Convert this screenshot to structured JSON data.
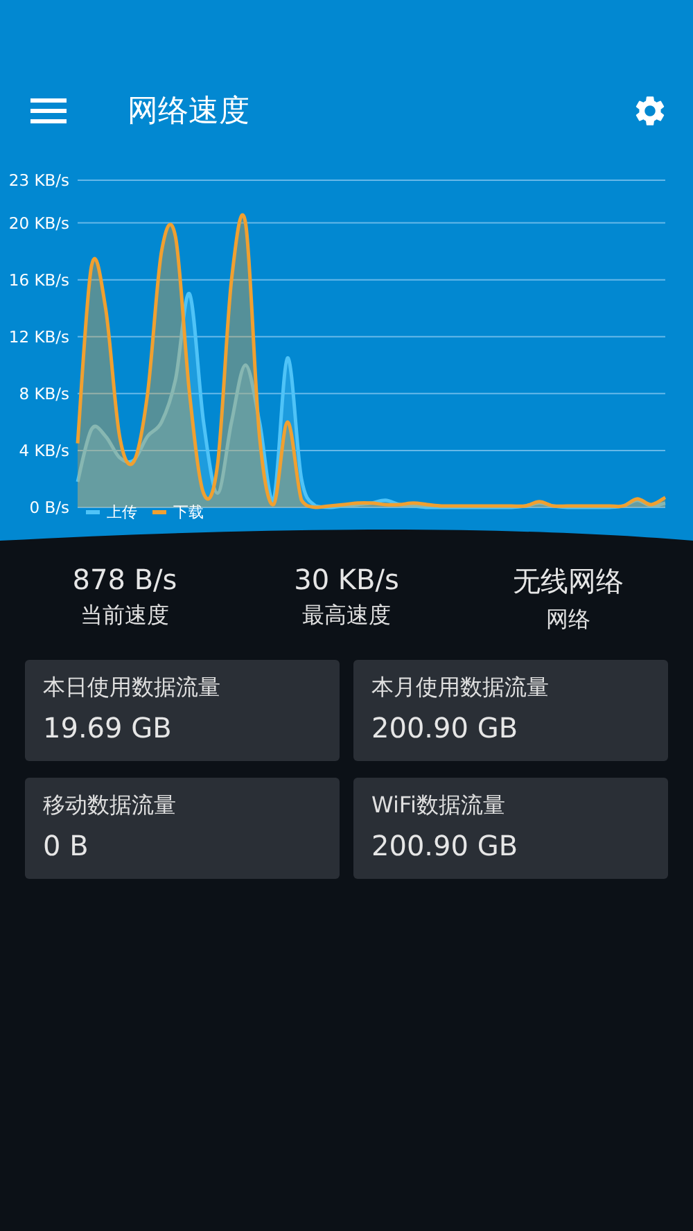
{
  "app_bar": {
    "title": "网络速度"
  },
  "chart": {
    "chart_data": {
      "type": "area",
      "grid": true,
      "ylim": [
        0,
        23
      ],
      "yticks": [
        {
          "value": 0,
          "label": "0 B/s"
        },
        {
          "value": 4,
          "label": "4 KB/s"
        },
        {
          "value": 8,
          "label": "8 KB/s"
        },
        {
          "value": 12,
          "label": "12 KB/s"
        },
        {
          "value": 16,
          "label": "16 KB/s"
        },
        {
          "value": 20,
          "label": "20 KB/s"
        },
        {
          "value": 23,
          "label": "23 KB/s"
        }
      ],
      "series": [
        {
          "name": "上传",
          "color": "#4fc3f7",
          "values": [
            1.8,
            5.5,
            5,
            3.5,
            3.3,
            5,
            6,
            9,
            15,
            6,
            1,
            6,
            10,
            6,
            0.5,
            10.5,
            2,
            0.1,
            0,
            0.1,
            0.2,
            0.3,
            0.5,
            0.2,
            0.1,
            0,
            0,
            0,
            0,
            0,
            0,
            0,
            0.1,
            0.3,
            0.1,
            0,
            0,
            0,
            0,
            0.1,
            0.5,
            0.1,
            0.3
          ]
        },
        {
          "name": "下载",
          "color": "#f0a030",
          "values": [
            4.5,
            17,
            14,
            5,
            3.2,
            8,
            18,
            19,
            8,
            1,
            3,
            16,
            20,
            5,
            0.2,
            6,
            0.5,
            0,
            0.1,
            0.2,
            0.3,
            0.3,
            0.2,
            0.2,
            0.3,
            0.2,
            0.1,
            0.1,
            0.1,
            0.1,
            0.1,
            0.1,
            0.1,
            0.4,
            0.1,
            0.1,
            0.1,
            0.1,
            0.1,
            0.1,
            0.6,
            0.2,
            0.7
          ]
        }
      ]
    }
  },
  "stats": [
    {
      "value": "878 B/s",
      "label": "当前速度"
    },
    {
      "value": "30 KB/s",
      "label": "最高速度"
    },
    {
      "value": "无线网络",
      "label": "网络"
    }
  ],
  "cards": [
    {
      "label": "本日使用数据流量",
      "value": "19.69 GB"
    },
    {
      "label": "本月使用数据流量",
      "value": "200.90 GB"
    },
    {
      "label": "移动数据流量",
      "value": "0 B"
    },
    {
      "label": "WiFi数据流量",
      "value": "200.90 GB"
    }
  ]
}
